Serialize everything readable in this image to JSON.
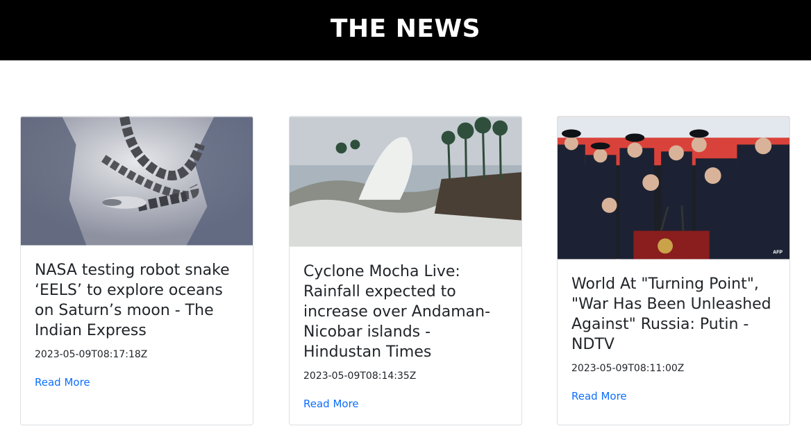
{
  "header": {
    "title": "THE NEWS"
  },
  "articles": [
    {
      "title": "NASA testing robot snake ‘EELS’ to explore oceans on Saturn’s moon - The Indian Express",
      "date": "2023-05-09T08:17:18Z",
      "link_label": "Read More",
      "image_icon": "robot-snake-image"
    },
    {
      "title": "Cyclone Mocha Live: Rainfall expected to increase over Andaman-Nicobar islands - Hindustan Times",
      "date": "2023-05-09T08:14:35Z",
      "link_label": "Read More",
      "image_icon": "storm-waves-image"
    },
    {
      "title": "World At \"Turning Point\", \"War Has Been Unleashed Against\" Russia: Putin - NDTV",
      "date": "2023-05-09T08:11:00Z",
      "link_label": "Read More",
      "image_icon": "military-parade-image",
      "image_watermark": "AFP"
    }
  ],
  "colors": {
    "header_bg": "#000000",
    "link": "#0d6efd",
    "text": "#212529"
  }
}
